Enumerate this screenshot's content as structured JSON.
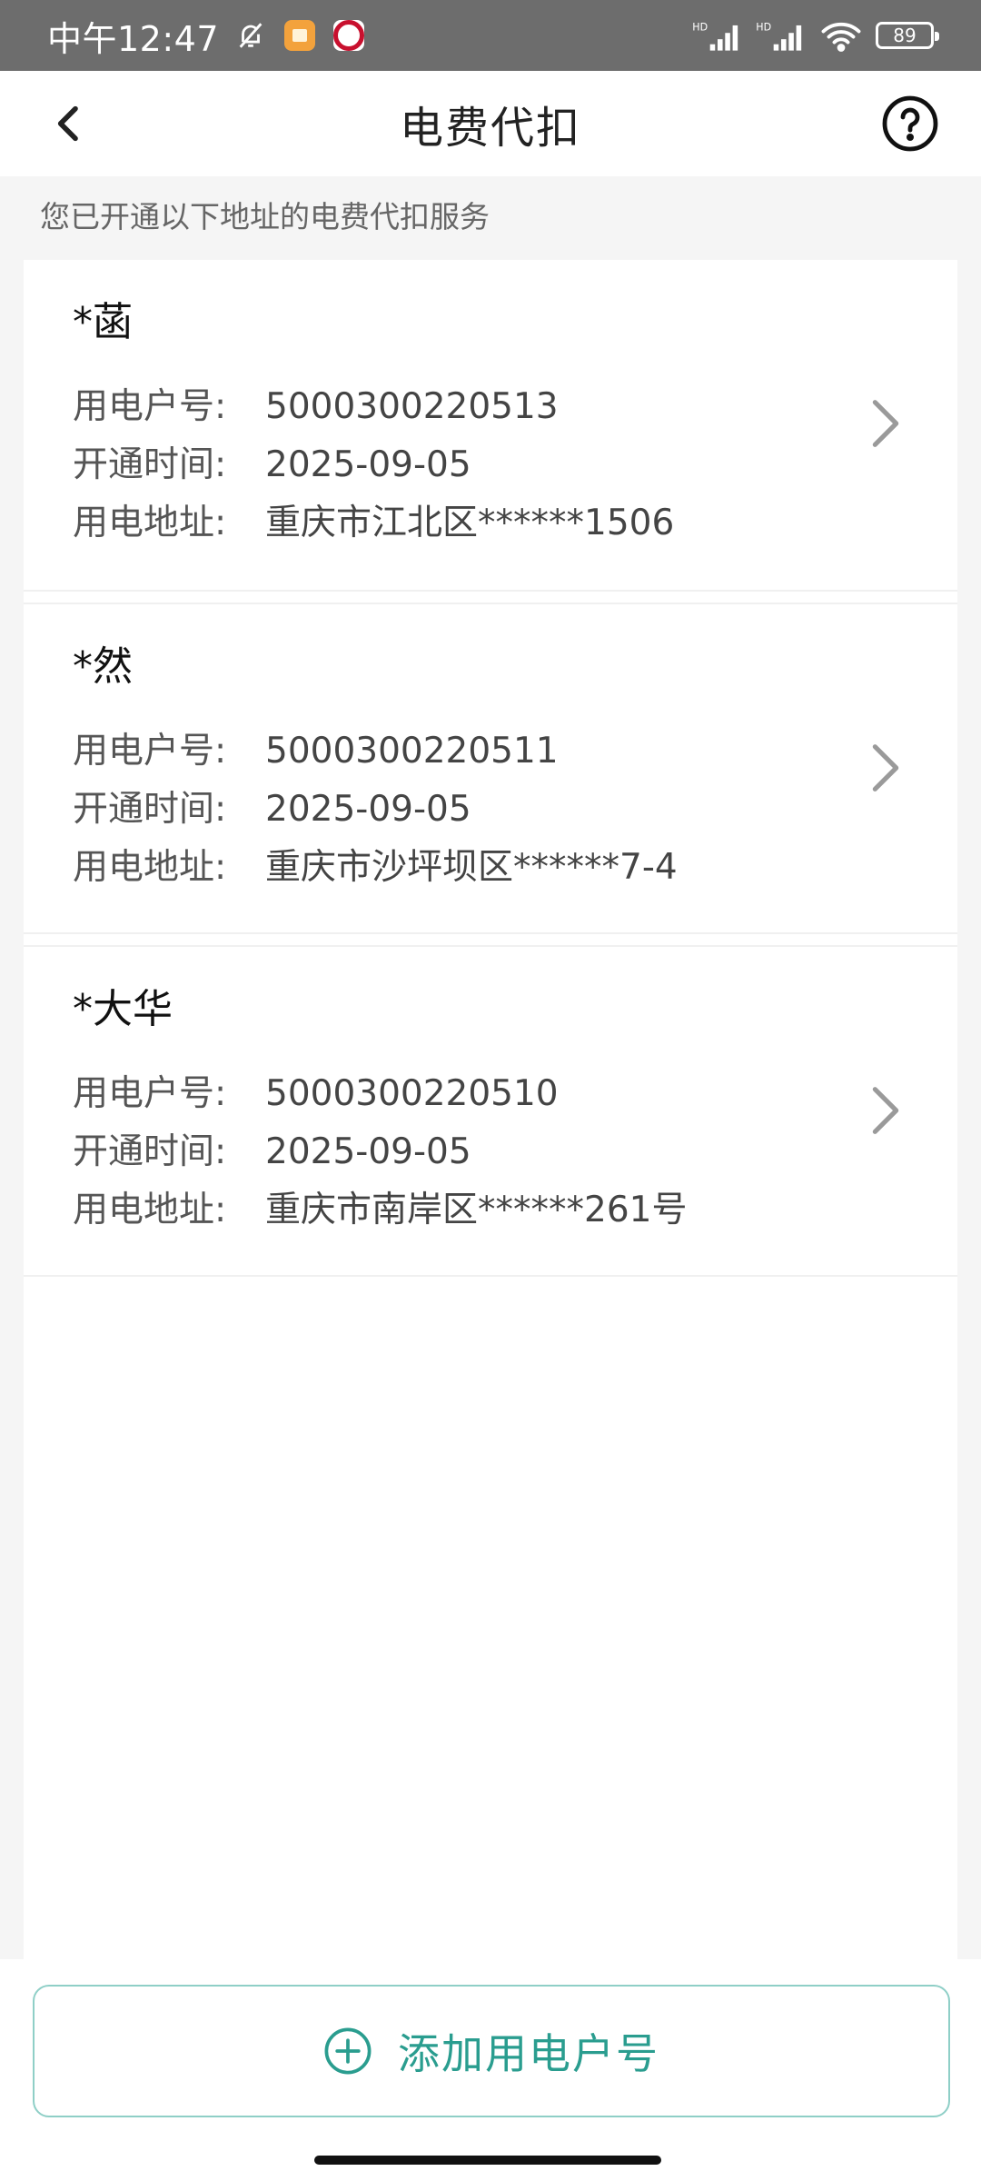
{
  "status_bar": {
    "time": "中午12:47",
    "battery": "89",
    "network_label": "HD"
  },
  "nav": {
    "title": "电费代扣"
  },
  "subtitle": "您已开通以下地址的电费代扣服务",
  "labels": {
    "account": "用电户号:",
    "opened": "开通时间:",
    "address": "用电地址:"
  },
  "accounts": [
    {
      "name": "*菡",
      "account_no": "5000300220513",
      "open_date": "2025-09-05",
      "address": "重庆市江北区******1506"
    },
    {
      "name": "*然",
      "account_no": "5000300220511",
      "open_date": "2025-09-05",
      "address": "重庆市沙坪坝区******7-4"
    },
    {
      "name": "*大华",
      "account_no": "5000300220510",
      "open_date": "2025-09-05",
      "address": "重庆市南岸区******261号"
    }
  ],
  "add_button": {
    "label": "添加用电户号"
  },
  "colors": {
    "accent": "#2a9d8f",
    "status_bar": "#6d6d6d"
  }
}
